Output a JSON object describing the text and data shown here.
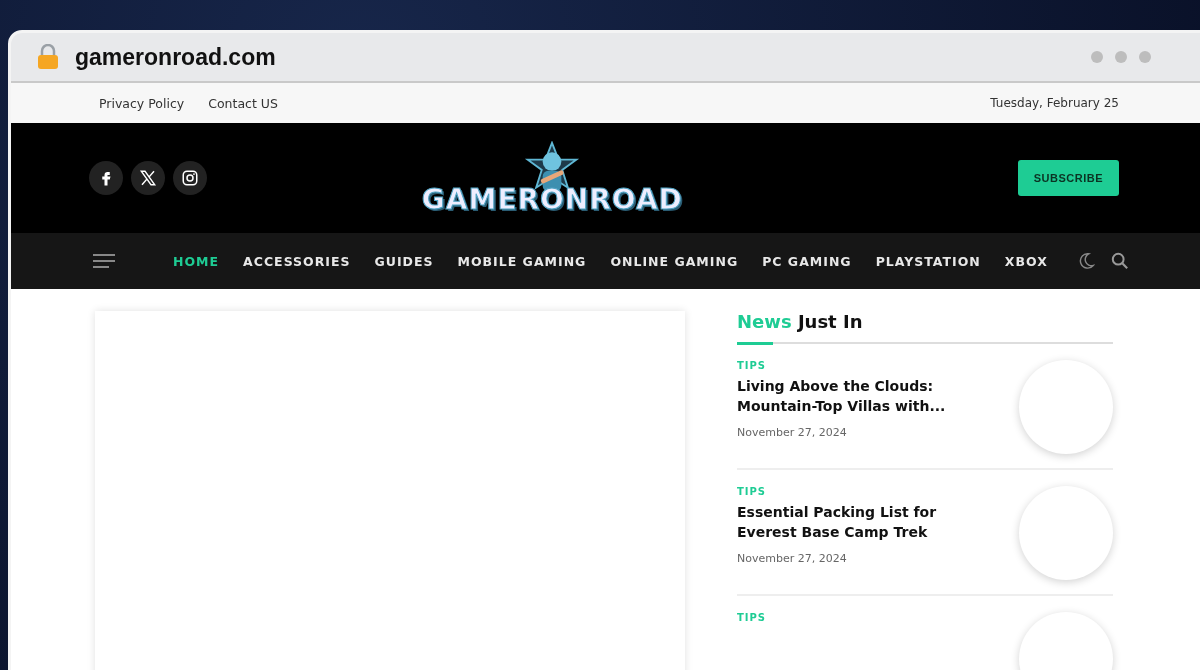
{
  "browser": {
    "url": "gameronroad.com"
  },
  "top_bar": {
    "links": [
      "Privacy Policy",
      "Contact US"
    ],
    "date": "Tuesday, February 25"
  },
  "header": {
    "logo": "GAMERONROAD",
    "social": [
      {
        "kind": "facebook"
      },
      {
        "kind": "x"
      },
      {
        "kind": "instagram"
      }
    ],
    "subscribe": "SUBSCRIBE"
  },
  "nav": {
    "items": [
      {
        "label": "HOME",
        "selected": true
      },
      {
        "label": "ACCESSORIES",
        "selected": false
      },
      {
        "label": "GUIDES",
        "selected": false
      },
      {
        "label": "MOBILE GAMING",
        "selected": false
      },
      {
        "label": "ONLINE GAMING",
        "selected": false
      },
      {
        "label": "PC GAMING",
        "selected": false
      },
      {
        "label": "PLAYSTATION",
        "selected": false
      },
      {
        "label": "XBOX",
        "selected": false
      }
    ]
  },
  "sidebar": {
    "heading_accent": "News",
    "heading": "Just In",
    "posts": [
      {
        "category": "TIPS",
        "title": "Living Above the Clouds: Mountain-Top Villas with...",
        "date": "November 27, 2024"
      },
      {
        "category": "TIPS",
        "title": "Essential Packing List for Everest Base Camp Trek",
        "date": "November 27, 2024"
      },
      {
        "category": "TIPS"
      }
    ]
  }
}
